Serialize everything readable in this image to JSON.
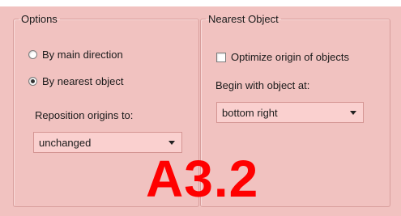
{
  "options": {
    "legend": "Options",
    "radios": [
      {
        "label": "By main direction",
        "checked": false
      },
      {
        "label": "By nearest object",
        "checked": true
      }
    ],
    "reposition_label": "Reposition origins to:",
    "reposition_value": "unchanged"
  },
  "nearest": {
    "legend": "Nearest Object",
    "optimize_label": "Optimize origin of objects",
    "optimize_checked": false,
    "begin_label": "Begin with object at:",
    "begin_value": "bottom right"
  },
  "overlay": {
    "text": "A3.2",
    "color": "#ff0000"
  },
  "colors": {
    "panel": "#f1c2c0",
    "combo": "#fad0cf",
    "border": "#d89e9c"
  }
}
